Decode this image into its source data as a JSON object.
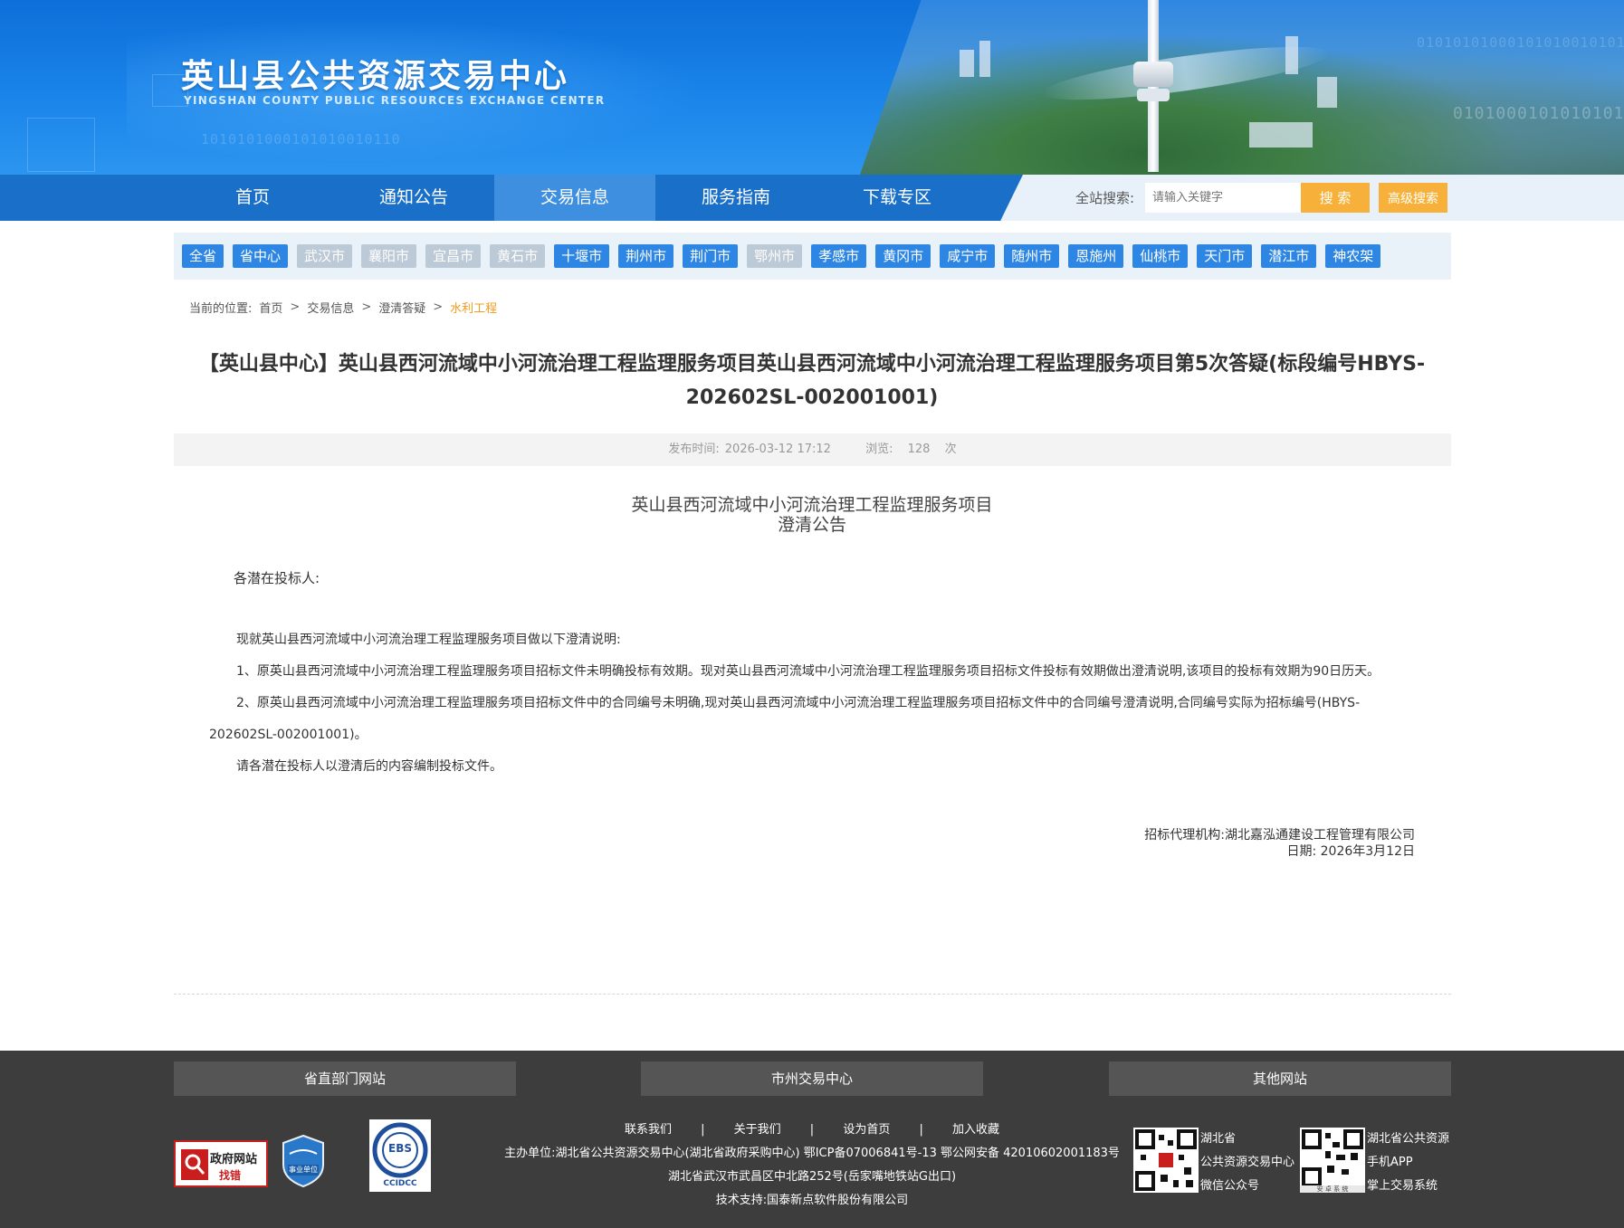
{
  "header": {
    "site_title": "英山县公共资源交易中心",
    "site_subtitle": "YINGSHAN COUNTY PUBLIC RESOURCES EXCHANGE CENTER"
  },
  "nav": {
    "items": [
      "首页",
      "通知公告",
      "交易信息",
      "服务指南",
      "下载专区"
    ],
    "active_index": 2,
    "search_label": "全站搜索:",
    "search_placeholder": "请输入关键字",
    "search_button": "搜 索",
    "advanced_search_button": "高级搜索"
  },
  "regions": [
    {
      "label": "全省",
      "active": true
    },
    {
      "label": "省中心",
      "active": true
    },
    {
      "label": "武汉市",
      "active": false
    },
    {
      "label": "襄阳市",
      "active": false
    },
    {
      "label": "宜昌市",
      "active": false
    },
    {
      "label": "黄石市",
      "active": false
    },
    {
      "label": "十堰市",
      "active": true
    },
    {
      "label": "荆州市",
      "active": true
    },
    {
      "label": "荆门市",
      "active": true
    },
    {
      "label": "鄂州市",
      "active": false
    },
    {
      "label": "孝感市",
      "active": true
    },
    {
      "label": "黄冈市",
      "active": true
    },
    {
      "label": "咸宁市",
      "active": true
    },
    {
      "label": "随州市",
      "active": true
    },
    {
      "label": "恩施州",
      "active": true
    },
    {
      "label": "仙桃市",
      "active": true
    },
    {
      "label": "天门市",
      "active": true
    },
    {
      "label": "潜江市",
      "active": true
    },
    {
      "label": "神农架",
      "active": true
    }
  ],
  "breadcrumb": {
    "prefix": "当前的位置:",
    "items": [
      "首页",
      "交易信息",
      "澄清答疑",
      "水利工程"
    ]
  },
  "article": {
    "title": "【英山县中心】英山县西河流域中小河流治理工程监理服务项目英山县西河流域中小河流治理工程监理服务项目第5次答疑(标段编号HBYS-202602SL-002001001)",
    "publish_label": "发布时间:",
    "publish_time": "2026-03-12 17:12",
    "views_label": "浏览:",
    "views_count": "128",
    "views_unit": "次",
    "doc_head_line1": "英山县西河流域中小河流治理工程监理服务项目",
    "doc_head_line2": "澄清公告",
    "salutation": "各潜在投标人:",
    "paragraphs": [
      "现就英山县西河流域中小河流治理工程监理服务项目做以下澄清说明:",
      "1、原英山县西河流域中小河流治理工程监理服务项目招标文件未明确投标有效期。现对英山县西河流域中小河流治理工程监理服务项目招标文件投标有效期做出澄清说明,该项目的投标有效期为90日历天。",
      "2、原英山县西河流域中小河流治理工程监理服务项目招标文件中的合同编号未明确,现对英山县西河流域中小河流治理工程监理服务项目招标文件中的合同编号澄清说明,合同编号实际为招标编号(HBYS-202602SL-002001001)。",
      "请各潜在投标人以澄清后的内容编制投标文件。"
    ],
    "agency": "招标代理机构:湖北嘉泓通建设工程管理有限公司",
    "date": "日期: 2026年3月12日"
  },
  "footer": {
    "tabs": [
      "省直部门网站",
      "市州交易中心",
      "其他网站"
    ],
    "links": [
      "联系我们",
      "关于我们",
      "设为首页",
      "加入收藏"
    ],
    "link_sep": "|",
    "host_line": "主办单位:湖北省公共资源交易中心(湖北省政府采购中心) 鄂ICP备07006841号-13 鄂公网安备 42010602001183号",
    "address_line": "湖北省武汉市武昌区中北路252号(岳家嘴地铁站G出口)",
    "support_line": "技术支持:国泰新点软件股份有限公司",
    "badge_gov_line1": "政府网站",
    "badge_gov_line2": "找错",
    "badge_shiye": "事业单位",
    "badge_ebs": "EBS",
    "badge_ebs_sub": "CCIDCC",
    "qr1_label": [
      "湖北省",
      "公共资源交易中心",
      "微信公众号"
    ],
    "qr2_label": [
      "湖北省公共资源",
      "手机APP",
      "掌上交易系统"
    ],
    "qr2_caption": "安 卓 系 统"
  },
  "colors": {
    "nav_blue": "#1a6fc8",
    "nav_active": "#3f8fe0",
    "chip_active": "#2e86e4",
    "chip_inactive": "#bcc9d6",
    "search_button": "#f7b13a",
    "breadcrumb_current": "#f29b1c",
    "footer_bg": "#3d3d3d"
  }
}
